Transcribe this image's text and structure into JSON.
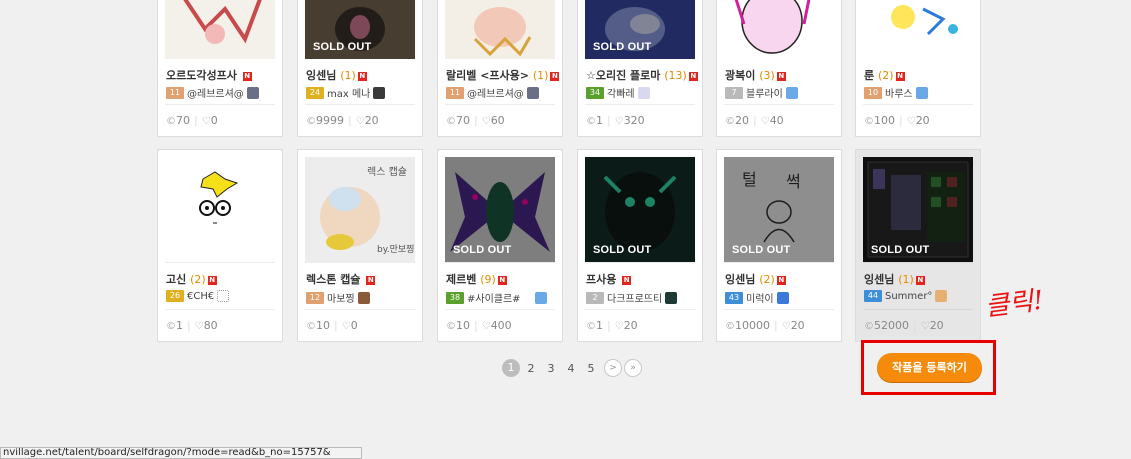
{
  "row1": [
    {
      "title": "오르도각성프사",
      "count": "",
      "level": "11",
      "level_color": "#e0a070",
      "seller": "@레브르셔@",
      "price": "70",
      "likes": "0",
      "sold_out": false
    },
    {
      "title": "잉센님",
      "count": "(1)",
      "level": "24",
      "level_color": "#e0b020",
      "seller": "max 메나",
      "price": "9999",
      "likes": "20",
      "sold_out": true
    },
    {
      "title": "랄리벨 <프사용>",
      "count": "(1)",
      "level": "11",
      "level_color": "#e0a070",
      "seller": "@레브르셔@",
      "price": "70",
      "likes": "60",
      "sold_out": false
    },
    {
      "title": "☆오리진 플로마",
      "count": "(13)",
      "level": "34",
      "level_color": "#5aa02c",
      "seller": "각빠레",
      "price": "1",
      "likes": "320",
      "sold_out": true
    },
    {
      "title": "광복이",
      "count": "(3)",
      "level": "7",
      "level_color": "#b9b9b9",
      "seller": "블루라이",
      "price": "20",
      "likes": "40",
      "sold_out": false
    },
    {
      "title": "룬",
      "count": "(2)",
      "level": "10",
      "level_color": "#e0a070",
      "seller": "바루스",
      "price": "100",
      "likes": "20",
      "sold_out": false
    }
  ],
  "row2": [
    {
      "title": "고신",
      "count": "(2)",
      "level": "26",
      "level_color": "#e0b020",
      "seller": "€CH€",
      "price": "1",
      "likes": "80",
      "sold_out": false
    },
    {
      "title": "렉스톤 캡슐",
      "count": "",
      "level": "12",
      "level_color": "#e0a070",
      "seller": "마보찡",
      "price": "10",
      "likes": "0",
      "sold_out": false
    },
    {
      "title": "제르벤",
      "count": "(9)",
      "level": "38",
      "level_color": "#5aa02c",
      "seller": "#사이클르#",
      "price": "10",
      "likes": "400",
      "sold_out": true
    },
    {
      "title": "프사용",
      "count": "",
      "level": "2",
      "level_color": "#b9b9b9",
      "seller": "다크프로뜨티",
      "price": "1",
      "likes": "20",
      "sold_out": true
    },
    {
      "title": "잉센님",
      "count": "(2)",
      "level": "43",
      "level_color": "#3f8fd8",
      "seller": "미럭이",
      "price": "10000",
      "likes": "20",
      "sold_out": true
    },
    {
      "title": "잉센님",
      "count": "(1)",
      "level": "44",
      "level_color": "#3f8fd8",
      "seller": "Summer°",
      "price": "52000",
      "likes": "20",
      "sold_out": true
    }
  ],
  "sold_out_label": "SOLD OUT",
  "new_badge": "N",
  "pagination": {
    "pages": [
      "1",
      "2",
      "3",
      "4",
      "5"
    ],
    "current": "1",
    "next": ">",
    "last": "»"
  },
  "register_button": "작품을 등록하기",
  "click_annotation": "클릭!",
  "status_url": "nvillage.net/talent/board/selfdragon/?mode=read&b_no=15757&"
}
